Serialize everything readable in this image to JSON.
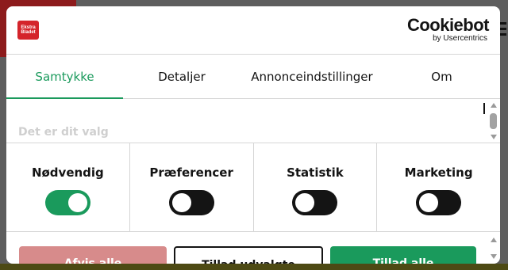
{
  "brand": {
    "logo_line1": "Ekstra",
    "logo_line2": "Bladet",
    "provider_name": "Cookiebot",
    "provider_sub": "by Usercentrics"
  },
  "tabs": [
    {
      "label": "Samtykke",
      "active": true
    },
    {
      "label": "Detaljer",
      "active": false
    },
    {
      "label": "Annonceindstillinger",
      "active": false
    },
    {
      "label": "Om",
      "active": false
    }
  ],
  "content": {
    "heading": "Det er dit valg"
  },
  "toggles": [
    {
      "label": "Nødvendig",
      "on": true
    },
    {
      "label": "Præferencer",
      "on": false
    },
    {
      "label": "Statistik",
      "on": false
    },
    {
      "label": "Marketing",
      "on": false
    }
  ],
  "buttons": {
    "deny": "Afvis alle",
    "select": "Tillad udvalgte",
    "allow": "Tillad alle"
  },
  "colors": {
    "accent": "#1a9a5c",
    "text": "#141414",
    "deny_bg": "#d78b8b"
  }
}
